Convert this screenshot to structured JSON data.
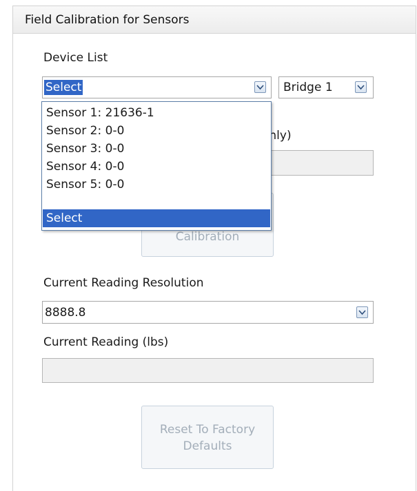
{
  "panel": {
    "title": "Field Calibration for Sensors"
  },
  "device_list": {
    "label": "Device List",
    "selected": "Select",
    "bridge_selected": "Bridge 1",
    "options": [
      {
        "label": "Sensor 1: 21636-1"
      },
      {
        "label": "Sensor 2: 0-0"
      },
      {
        "label": "Sensor 3: 0-0"
      },
      {
        "label": "Sensor 4: 0-0"
      },
      {
        "label": "Sensor 5: 0-0"
      },
      {
        "label": "Select"
      }
    ],
    "highlighted_option": "Select"
  },
  "obscured": {
    "label_fragment": "only)",
    "calibration_button_fragment": "Calibration"
  },
  "resolution": {
    "label": "Current Reading Resolution",
    "value": "8888.8"
  },
  "reading": {
    "label": "Current Reading (lbs)",
    "value": ""
  },
  "reset_button": {
    "line1": "Reset To Factory",
    "line2": "Defaults"
  },
  "colors": {
    "selection": "#3166c6",
    "disabled_text": "#a3aeb9"
  }
}
